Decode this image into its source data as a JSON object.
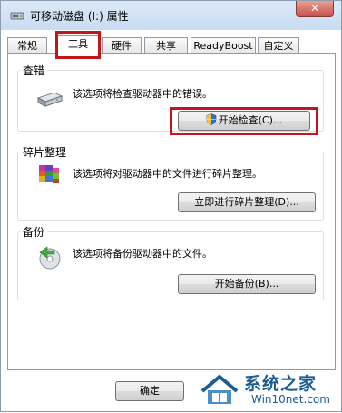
{
  "window": {
    "title": "可移动磁盘 (I:) 属性",
    "close_label": "✕"
  },
  "tabs": [
    {
      "label": "常规"
    },
    {
      "label": "工具"
    },
    {
      "label": "硬件"
    },
    {
      "label": "共享"
    },
    {
      "label": "ReadyBoost"
    },
    {
      "label": "自定义"
    }
  ],
  "active_tab": "工具",
  "sections": {
    "check": {
      "label": "查错",
      "description": "该选项将检查驱动器中的错误。",
      "button": "开始检查(C)..."
    },
    "defrag": {
      "label": "碎片整理",
      "description": "该选项将对驱动器中的文件进行碎片整理。",
      "button": "立即进行碎片整理(D)..."
    },
    "backup": {
      "label": "备份",
      "description": "该选项将备份驱动器中的文件。",
      "button": "开始备份(B)..."
    }
  },
  "footer": {
    "ok_label": "确定"
  },
  "watermark": {
    "brand": "系统之家",
    "url": "Win10net.com"
  },
  "colors": {
    "highlight": "#c0161c",
    "watermark_blue": "#1c5d94"
  }
}
